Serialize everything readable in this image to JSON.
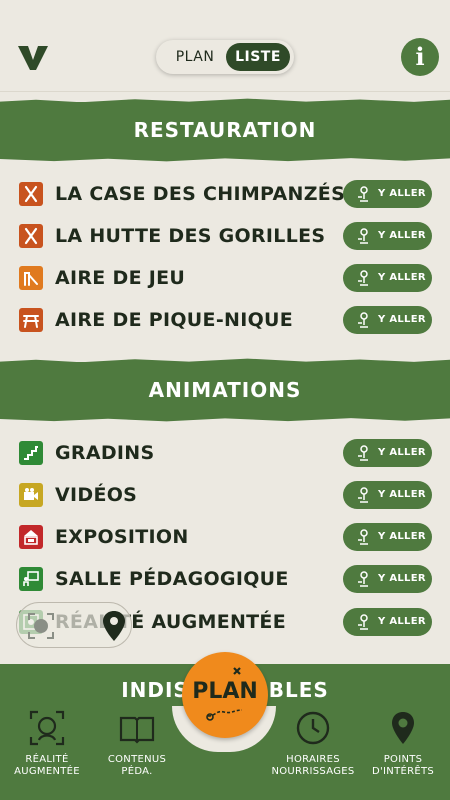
{
  "header": {
    "logo": "V",
    "toggle_plan": "PLAN",
    "toggle_liste": "LISTE",
    "info": "i"
  },
  "sections": [
    {
      "title": "RESTAURATION",
      "items": [
        {
          "label": "LA CASE DES CHIMPANZÉS",
          "icon": "utensils-icon",
          "color": "#c8531e",
          "action": "Y ALLER"
        },
        {
          "label": "LA HUTTE DES GORILLES",
          "icon": "utensils-icon",
          "color": "#c8531e",
          "action": "Y ALLER"
        },
        {
          "label": "AIRE DE JEU",
          "icon": "playground-slide-icon",
          "color": "#e07a1f",
          "action": "Y ALLER"
        },
        {
          "label": "AIRE DE PIQUE-NIQUE",
          "icon": "picnic-table-icon",
          "color": "#c8531e",
          "action": "Y ALLER"
        }
      ]
    },
    {
      "title": "ANIMATIONS",
      "items": [
        {
          "label": "GRADINS",
          "icon": "stairs-icon",
          "color": "#2f8a36",
          "action": "Y ALLER"
        },
        {
          "label": "VIDÉOS",
          "icon": "video-camera-icon",
          "color": "#c7a722",
          "action": "Y ALLER"
        },
        {
          "label": "EXPOSITION",
          "icon": "exhibition-icon",
          "color": "#c2282a",
          "action": "Y ALLER"
        },
        {
          "label": "SALLE PÉDAGOGIQUE",
          "icon": "classroom-icon",
          "color": "#2f8a36",
          "action": "Y ALLER"
        },
        {
          "label": "RÉALITÉ AUGMENTÉE",
          "icon": "augmented-reality-icon",
          "color": "#2f8a36",
          "action": "Y ALLER"
        }
      ]
    }
  ],
  "bottom_section_title": "INDISPENSABLES",
  "tabbar": {
    "items": [
      {
        "label": "RÉALITÉ AUGMENTÉE",
        "icon": "gorilla-scan-icon"
      },
      {
        "label": "CONTENUS PÉDA.",
        "icon": "open-book-icon"
      },
      {
        "label": "HORAIRES NOURRISSAGES",
        "icon": "clock-icon"
      },
      {
        "label": "POINTS D'INTÉRÊTS",
        "icon": "map-pin-icon"
      }
    ],
    "center_button": "PLAN"
  },
  "colors": {
    "brand_green": "#4f7a3f",
    "dark_green": "#2f4a28",
    "background": "#ece9e1",
    "orange": "#f08a1c"
  }
}
